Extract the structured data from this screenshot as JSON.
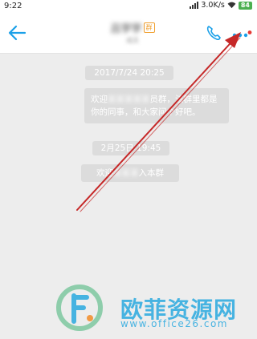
{
  "status_bar": {
    "time": "9:22",
    "network_speed": "3.0K/s",
    "battery": "84"
  },
  "header": {
    "title": "吕学学",
    "group_tag": "群",
    "subtitle": "成员",
    "icons": [
      "back-arrow-icon",
      "phone-icon",
      "more-dots-icon"
    ],
    "accent_color": "#1aa0e8",
    "notification_dot_color": "#e53935"
  },
  "chat": {
    "timestamp_1": "2017/7/24 20:25",
    "message_1": {
      "prefix": "欢迎",
      "hidden_name": "某某某某某",
      "suffix": "员群，该群里都是你的同事，和大家问个好吧。"
    },
    "timestamp_2": "2月25日 19:45",
    "message_2": {
      "prefix": "欢迎",
      "hidden_name": "某某某",
      "suffix": "入本群"
    }
  },
  "watermark": {
    "title": "欧菲资源网",
    "url": "www.office26.com"
  },
  "annotation": {
    "arrow_color": "#c62828"
  }
}
